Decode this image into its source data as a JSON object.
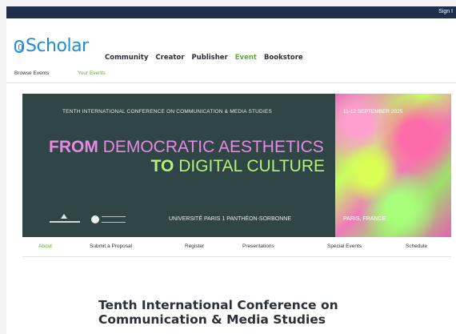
{
  "topbar": {
    "signin_label": "Sign I"
  },
  "header": {
    "logo_text": "Scholar",
    "nav": [
      {
        "label": "Community",
        "active": false
      },
      {
        "label": "Creator",
        "active": false
      },
      {
        "label": "Publisher",
        "active": false
      },
      {
        "label": "Event",
        "active": true
      },
      {
        "label": "Bookstore",
        "active": false
      }
    ]
  },
  "subnav": {
    "browse_label": "Browse Events",
    "your_label": "Your Events"
  },
  "banner": {
    "top_text": "TENTH INTERNATIONAL CONFERENCE ON COMMUNICATION & MEDIA STUDIES",
    "head1_strong": "FROM",
    "head1_light": "DEMOCRATIC AESTHETICS",
    "head2_strong": "TO",
    "head2_light": "DIGITAL CULTURE",
    "university": "UNIVERSITÉ PARIS 1 PANTHÉON-SORBONNE",
    "dates": "11-12 SEPTEMBER 2025",
    "city": "PARIS, FRANCE"
  },
  "event_nav": {
    "about": "About",
    "submit": "Submit a Proposal",
    "register": "Register",
    "presentations": "Presentations",
    "special": "Special Events",
    "schedule": "Schedule"
  },
  "page_title": "Tenth International Conference on Communication & Media Studies",
  "colors": {
    "accent_blue": "#1e8ed0",
    "accent_green": "#5db02e",
    "topbar": "#1f2e4a",
    "banner_bg": "#2f4546"
  }
}
